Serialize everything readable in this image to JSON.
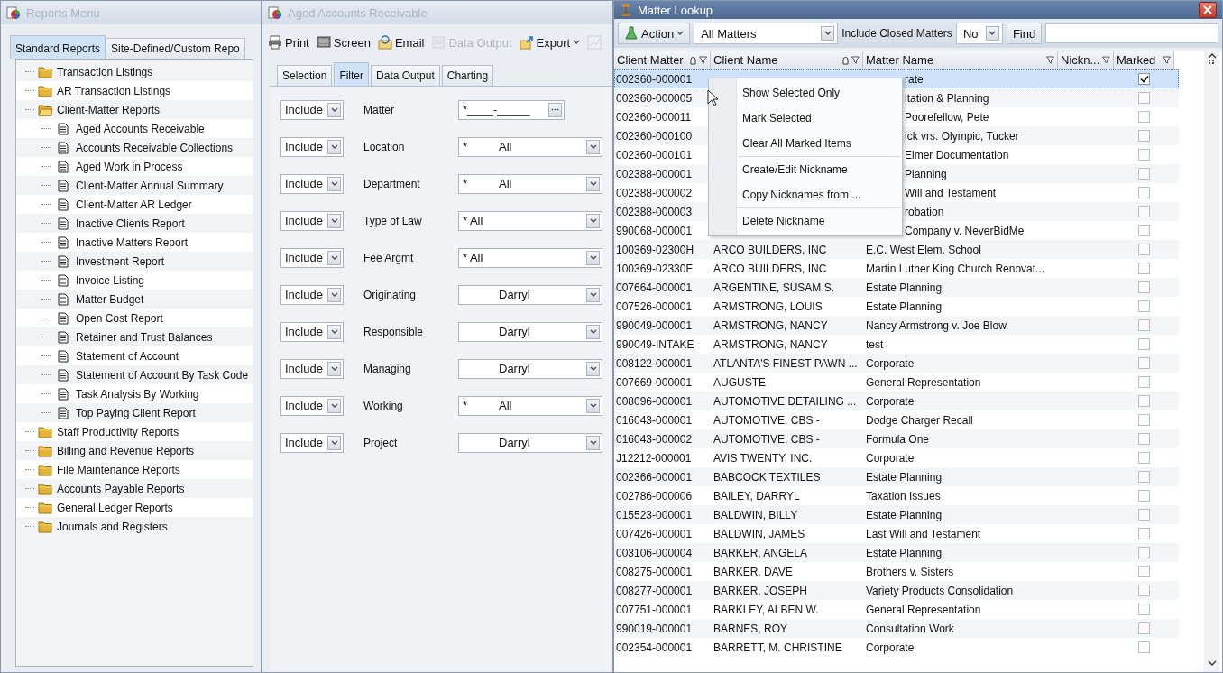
{
  "reports_menu": {
    "title": "Reports Menu",
    "active": false,
    "tabs": [
      {
        "label": "Standard Reports",
        "selected": true
      },
      {
        "label": "Site-Defined/Custom Repo",
        "selected": false
      }
    ],
    "tree": [
      {
        "label": "Transaction Listings",
        "kind": "folder",
        "expanded": false
      },
      {
        "label": "AR Transaction Listings",
        "kind": "folder",
        "expanded": false
      },
      {
        "label": "Client-Matter Reports",
        "kind": "folder",
        "expanded": true,
        "children": [
          {
            "label": "Aged Accounts Receivable",
            "kind": "report"
          },
          {
            "label": "Accounts Receivable Collections",
            "kind": "report"
          },
          {
            "label": "Aged Work in Process",
            "kind": "report"
          },
          {
            "label": "Client-Matter Annual Summary",
            "kind": "report"
          },
          {
            "label": "Client-Matter AR Ledger",
            "kind": "report"
          },
          {
            "label": "Inactive Clients Report",
            "kind": "report"
          },
          {
            "label": "Inactive Matters Report",
            "kind": "report"
          },
          {
            "label": "Investment Report",
            "kind": "report"
          },
          {
            "label": "Invoice Listing",
            "kind": "report"
          },
          {
            "label": "Matter Budget",
            "kind": "report"
          },
          {
            "label": "Open Cost Report",
            "kind": "report"
          },
          {
            "label": "Retainer and Trust Balances",
            "kind": "report"
          },
          {
            "label": "Statement of Account",
            "kind": "report"
          },
          {
            "label": "Statement of Account By Task Code",
            "kind": "report"
          },
          {
            "label": "Task Analysis By Working",
            "kind": "report"
          },
          {
            "label": "Top Paying Client Report",
            "kind": "report"
          }
        ]
      },
      {
        "label": "Staff Productivity Reports",
        "kind": "folder",
        "expanded": false
      },
      {
        "label": "Billing and Revenue Reports",
        "kind": "folder",
        "expanded": false
      },
      {
        "label": "File Maintenance Reports",
        "kind": "folder",
        "expanded": false
      },
      {
        "label": "Accounts Payable Reports",
        "kind": "folder",
        "expanded": false
      },
      {
        "label": "General Ledger Reports",
        "kind": "folder",
        "expanded": false
      },
      {
        "label": "Journals and Registers",
        "kind": "folder",
        "expanded": false
      }
    ]
  },
  "report_window": {
    "title": "Aged Accounts Receivable",
    "active": false,
    "toolbar": [
      {
        "kind": "printer",
        "label": "Print",
        "disabled": false
      },
      {
        "kind": "screen",
        "label": "Screen",
        "disabled": false
      },
      {
        "kind": "email",
        "label": "Email",
        "disabled": false
      },
      {
        "kind": "data",
        "label": "Data Output",
        "disabled": true
      },
      {
        "kind": "export",
        "label": "Export",
        "disabled": false
      },
      {
        "kind": "chart",
        "disabled": true
      }
    ],
    "tabs": [
      {
        "label": "Selection",
        "selected": false
      },
      {
        "label": "Filter",
        "selected": true
      },
      {
        "label": "Data Output",
        "selected": false
      },
      {
        "label": "Charting",
        "selected": false
      }
    ],
    "filters": [
      {
        "mode": "Include",
        "label": "Matter",
        "kind": "lookup",
        "value": "*____-_____"
      },
      {
        "mode": "Include",
        "label": "Location",
        "kind": "coded",
        "prefix": "*",
        "value": "All"
      },
      {
        "mode": "Include",
        "label": "Department",
        "kind": "coded",
        "prefix": "*",
        "value": "All"
      },
      {
        "mode": "Include",
        "label": "Type of Law",
        "kind": "dropdown",
        "value": "* All"
      },
      {
        "mode": "Include",
        "label": "Fee Argmt",
        "kind": "dropdown",
        "value": "* All"
      },
      {
        "mode": "Include",
        "label": "Originating",
        "kind": "coded",
        "value": "Darryl"
      },
      {
        "mode": "Include",
        "label": "Responsible",
        "kind": "coded",
        "value": "Darryl"
      },
      {
        "mode": "Include",
        "label": "Managing",
        "kind": "coded",
        "value": "Darryl"
      },
      {
        "mode": "Include",
        "label": "Working",
        "kind": "coded",
        "prefix": "*",
        "value": "All"
      },
      {
        "mode": "Include",
        "label": "Project",
        "kind": "coded",
        "value": "Darryl"
      }
    ]
  },
  "matter_lookup": {
    "title": "Matter Lookup",
    "active": true,
    "toolbar": {
      "action": "Action",
      "view": "All Matters",
      "closed_label": "Include Closed Matters",
      "closed_value": "No",
      "find": "Find"
    },
    "columns": [
      {
        "label": "Client Matter",
        "sorted": true
      },
      {
        "label": "Client Name",
        "sorted": true
      },
      {
        "label": "Matter Name",
        "sorted": false
      },
      {
        "label": "Nickn...",
        "sorted": false
      },
      {
        "label": "Marked",
        "sorted": false
      }
    ],
    "rows": [
      {
        "client_matter": "002360-000001",
        "matter_name": "rate",
        "marked": true,
        "selected": true
      },
      {
        "client_matter": "002360-000005",
        "matter_name": "ltation & Planning",
        "marked": false,
        "selected": false
      },
      {
        "client_matter": "002360-000011",
        "matter_name": "Poorefellow, Pete",
        "marked": false,
        "selected": false
      },
      {
        "client_matter": "002360-000100",
        "matter_name": "ick vrs. Olympic, Tucker",
        "marked": false,
        "selected": false
      },
      {
        "client_matter": "002360-000101",
        "matter_name": "Elmer Documentation",
        "marked": false,
        "selected": false
      },
      {
        "client_matter": "002388-000001",
        "matter_name": "Planning",
        "marked": false,
        "selected": false
      },
      {
        "client_matter": "002388-000002",
        "matter_name": "Will and Testament",
        "marked": false,
        "selected": false
      },
      {
        "client_matter": "002388-000003",
        "matter_name": "robation",
        "marked": false,
        "selected": false
      },
      {
        "client_matter": "990068-000001",
        "matter_name": "Company v. NeverBidMe",
        "marked": false,
        "selected": false
      },
      {
        "client_matter": "100369-02300H",
        "client_name": "ARCO BUILDERS, INC",
        "matter_name": "E.C. West Elem. School",
        "marked": false,
        "selected": false
      },
      {
        "client_matter": "100369-02330F",
        "client_name": "ARCO BUILDERS, INC",
        "matter_name": "Martin Luther King Church Renovat...",
        "marked": false,
        "selected": false
      },
      {
        "client_matter": "007664-000001",
        "client_name": "ARGENTINE, SUSAM S.",
        "matter_name": "Estate Planning",
        "marked": false,
        "selected": false
      },
      {
        "client_matter": "007526-000001",
        "client_name": "ARMSTRONG, LOUIS",
        "matter_name": "Estate Planning",
        "marked": false,
        "selected": false
      },
      {
        "client_matter": "990049-000001",
        "client_name": "ARMSTRONG, NANCY",
        "matter_name": "Nancy Armstrong v. Joe Blow",
        "marked": false,
        "selected": false
      },
      {
        "client_matter": "990049-INTAKE",
        "client_name": "ARMSTRONG, NANCY",
        "matter_name": "test",
        "marked": false,
        "selected": false
      },
      {
        "client_matter": "008122-000001",
        "client_name": "ATLANTA'S FINEST PAWN ...",
        "matter_name": "Corporate",
        "marked": false,
        "selected": false
      },
      {
        "client_matter": "007669-000001",
        "client_name": "AUGUSTE",
        "matter_name": "General Representation",
        "marked": false,
        "selected": false
      },
      {
        "client_matter": "008096-000001",
        "client_name": "AUTOMOTIVE DETAILING ...",
        "matter_name": "Corporate",
        "marked": false,
        "selected": false
      },
      {
        "client_matter": "016043-000001",
        "client_name": "AUTOMOTIVE, CBS -",
        "matter_name": "Dodge Charger Recall",
        "marked": false,
        "selected": false
      },
      {
        "client_matter": "016043-000002",
        "client_name": "AUTOMOTIVE, CBS -",
        "matter_name": "Formula One",
        "marked": false,
        "selected": false
      },
      {
        "client_matter": "J12212-000001",
        "client_name": "AVIS TWENTY, INC.",
        "matter_name": "Corporate",
        "marked": false,
        "selected": false
      },
      {
        "client_matter": "002366-000001",
        "client_name": "BABCOCK TEXTILES",
        "matter_name": "Estate Planning",
        "marked": false,
        "selected": false
      },
      {
        "client_matter": "002786-000006",
        "client_name": "BAILEY, DARRYL",
        "matter_name": "Taxation Issues",
        "marked": false,
        "selected": false
      },
      {
        "client_matter": "015523-000001",
        "client_name": "BALDWIN, BILLY",
        "matter_name": "Estate Planning",
        "marked": false,
        "selected": false
      },
      {
        "client_matter": "007426-000001",
        "client_name": "BALDWIN, JAMES",
        "matter_name": "Last Will and Testament",
        "marked": false,
        "selected": false
      },
      {
        "client_matter": "003106-000004",
        "client_name": "BARKER, ANGELA",
        "matter_name": "Estate Planning",
        "marked": false,
        "selected": false
      },
      {
        "client_matter": "008275-000001",
        "client_name": "BARKER, DAVE",
        "matter_name": "Brothers v. Sisters",
        "marked": false,
        "selected": false
      },
      {
        "client_matter": "008277-000001",
        "client_name": "BARKER, JOSEPH",
        "matter_name": "Variety Products Consolidation",
        "marked": false,
        "selected": false
      },
      {
        "client_matter": "007751-000001",
        "client_name": "BARKLEY, ALBEN W.",
        "matter_name": "General Representation",
        "marked": false,
        "selected": false
      },
      {
        "client_matter": "990019-000001",
        "client_name": "BARNES, ROY",
        "matter_name": "Consultation Work",
        "marked": false,
        "selected": false
      },
      {
        "client_matter": "002354-000001",
        "client_name": "BARRETT, M. CHRISTINE",
        "matter_name": "Corporate",
        "marked": false,
        "selected": false
      }
    ],
    "context_menu": {
      "groups": [
        [
          "Show Selected Only",
          "Mark Selected",
          "Clear All Marked Items"
        ],
        [
          "Create/Edit Nickname",
          "Copy Nicknames from ..."
        ],
        [
          "Delete Nickname"
        ]
      ]
    }
  }
}
